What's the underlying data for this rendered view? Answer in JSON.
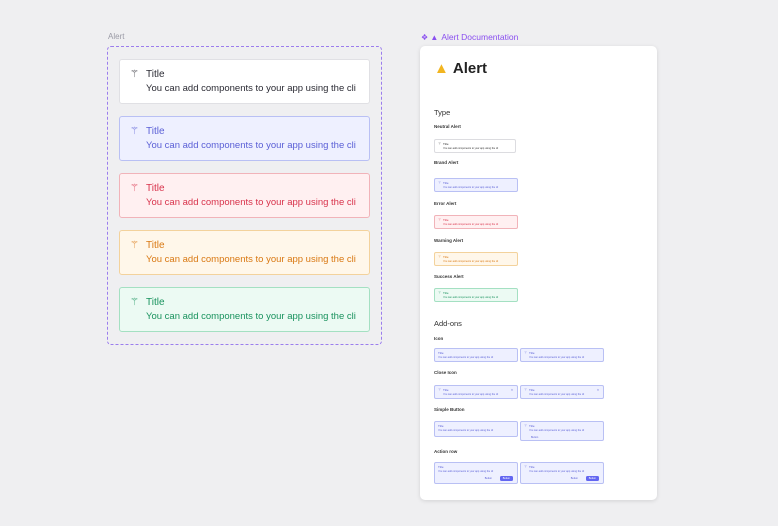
{
  "left": {
    "frame_label": "Alert",
    "alerts": [
      {
        "variant": "neutral",
        "title": "Title",
        "text": "You can add components to your app using the cli"
      },
      {
        "variant": "brand",
        "title": "Title",
        "text": "You can add components to your app using the cli"
      },
      {
        "variant": "error",
        "title": "Title",
        "text": "You can add components to your app using the cli"
      },
      {
        "variant": "warning",
        "title": "Title",
        "text": "You can add components to your app using the cli"
      },
      {
        "variant": "success",
        "title": "Title",
        "text": "You can add components to your app using the cli"
      }
    ]
  },
  "doc": {
    "label": "Alert Documentation",
    "title": "Alert",
    "type_heading": "Type",
    "types": [
      {
        "name": "Neutral Alert",
        "variant": "neutral"
      },
      {
        "name": "Brand Alert",
        "variant": "brand"
      },
      {
        "name": "Error Alert",
        "variant": "error"
      },
      {
        "name": "Warning Alert",
        "variant": "warning"
      },
      {
        "name": "Success Alert",
        "variant": "success"
      }
    ],
    "addons_heading": "Add-ons",
    "addons": [
      {
        "name": "Icon"
      },
      {
        "name": "Close Icon"
      },
      {
        "name": "Simple Button"
      },
      {
        "name": "Action row"
      }
    ],
    "mini_title": "Title",
    "mini_button": "Button"
  },
  "colors": {
    "brand": "#5a5fd6",
    "error": "#d8324b",
    "warning": "#d97812",
    "success": "#18925d",
    "accent": "#8a4ff0"
  },
  "icons": {
    "alert": "magic-wand-icon",
    "doc_label": "component-icon",
    "doc_title": "warning-icon",
    "close": "close-icon"
  }
}
